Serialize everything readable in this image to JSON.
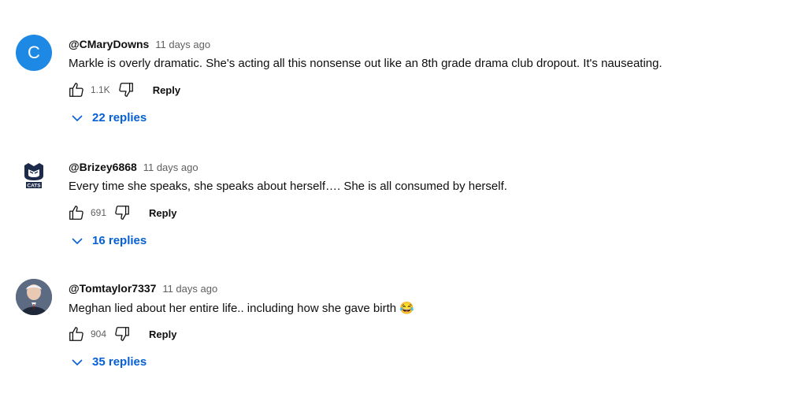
{
  "comments": [
    {
      "author": "@CMaryDowns",
      "time": "11 days ago",
      "avatar_letter": "C",
      "text": "Markle is overly dramatic.  She's acting all this nonsense out like an 8th grade drama club dropout.  It's nauseating.",
      "likes": "1.1K",
      "reply_label": "Reply",
      "replies_label": "22 replies"
    },
    {
      "author": "@Brizey6868",
      "time": "11 days ago",
      "avatar_text": "CATS",
      "text": "Every time she speaks, she speaks about herself…. She is all consumed by herself.",
      "likes": "691",
      "reply_label": "Reply",
      "replies_label": "16 replies"
    },
    {
      "author": "@Tomtaylor7337",
      "time": "11 days ago",
      "text": "Meghan lied about her entire life.. including how she gave birth 😂",
      "likes": "904",
      "reply_label": "Reply",
      "replies_label": "35 replies"
    }
  ],
  "colors": {
    "link": "#065fd4",
    "avatar_c": "#1e88e5",
    "muted": "#606060"
  }
}
